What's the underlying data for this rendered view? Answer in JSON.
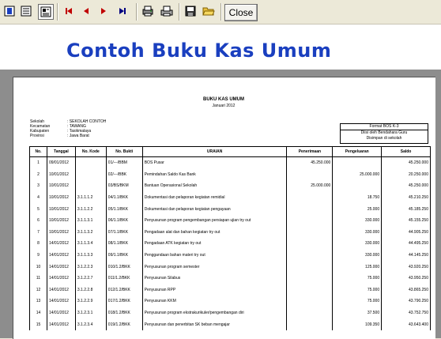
{
  "toolbar": {
    "close_label": "Close"
  },
  "page": {
    "heading": "Contoh Buku Kas Umum"
  },
  "report": {
    "title": "BUKU KAS UMUM",
    "period": "Januari 2012",
    "info": [
      {
        "label": "Sekolah",
        "value": ": SEKOLAH CONTOH"
      },
      {
        "label": "Kecamatan",
        "value": ": TAWANG"
      },
      {
        "label": "Kabupaten",
        "value": ": Tasikmalaya"
      },
      {
        "label": "Provinsi",
        "value": ": Jawa Barat"
      }
    ],
    "format_box": "Format BOS K-3",
    "right_note_1": "Diisi oleh Bendahara Guru",
    "right_note_2": "Disimpan di sekolah",
    "columns": [
      "No.",
      "Tanggal",
      "No. Kode",
      "No. Bukti",
      "URAIAN",
      "Penerimaan",
      "Pengeluaran",
      "Saldo"
    ],
    "rows": [
      [
        "1",
        "09/01/2012",
        "",
        "01/---/BBM",
        "BOS Pusar",
        "45.250.000",
        "",
        "45.250.000"
      ],
      [
        "2",
        "10/01/2012",
        "",
        "02/---/BBK",
        "Pemindahan Saldo Kas Bank",
        "",
        "25.000.000",
        "20.250.000"
      ],
      [
        "3",
        "10/01/2012",
        "",
        "03/BS/BKM",
        "Bantuan Operasional Sekolah",
        "25.000.000",
        "",
        "45.250.000"
      ],
      [
        "4",
        "10/01/2012",
        "3.1.1.1.2",
        "04/1.1/BKK",
        "Dokumentasi dan pelaporan kegiatan remidial",
        "",
        "18.750",
        "45.210.250"
      ],
      [
        "5",
        "10/01/2012",
        "3.1.1.2.2",
        "05/1.1/BKK",
        "Dokumentasi dan pelaporan kegiatan pengayaan",
        "",
        "25.000",
        "45.185.250"
      ],
      [
        "6",
        "10/01/2012",
        "3.1.1.3.1",
        "06/1.1/BKK",
        "Penyusunan program pengembangan persiapan ujian try out",
        "",
        "330.000",
        "45.155.250"
      ],
      [
        "7",
        "10/01/2012",
        "3.1.1.3.2",
        "07/1.1/BKK",
        "Pengadaan alat dan bahan kegiatan try out",
        "",
        "330.000",
        "44.905.250"
      ],
      [
        "8",
        "14/01/2012",
        "3.1.1.3.4",
        "08/1.1/BKK",
        "Pengadaan ATK kegiatan try out",
        "",
        "330.000",
        "44.495.250"
      ],
      [
        "9",
        "14/01/2012",
        "3.1.1.3.3",
        "09/1.1/BKK",
        "Penggandaan bahan materi try out",
        "",
        "330.000",
        "44.145.250"
      ],
      [
        "10",
        "14/01/2012",
        "3.1.2.2.3",
        "010/1.2/BKK",
        "Penyusunan program semester",
        "",
        "125.000",
        "43.920.250"
      ],
      [
        "11",
        "14/01/2012",
        "3.1.2.2.7",
        "011/1.2/BKK",
        "Penyusunan Silabus",
        "",
        "75.000",
        "43.950.250"
      ],
      [
        "12",
        "14/01/2012",
        "3.1.2.2.8",
        "012/1.2/BKK",
        "Penyusunan RPP",
        "",
        "75.000",
        "43.865.250"
      ],
      [
        "13",
        "14/01/2012",
        "3.1.2.2.9",
        "017/1.2/BKK",
        "Penyusunan KKM",
        "",
        "75.000",
        "43.790.250"
      ],
      [
        "14",
        "14/01/2012",
        "3.1.2.3.1",
        "018/1.2/BKK",
        "Penyusunan program ekstrakurikuler/pengembangan diri",
        "",
        "37.500",
        "43.752.750"
      ],
      [
        "15",
        "14/01/2012",
        "3.1.2.3.4",
        "019/1.2/BKK",
        "Penyusunan dan penerbitan SK beban mengajar",
        "",
        "109.350",
        "43.643.400"
      ]
    ]
  }
}
